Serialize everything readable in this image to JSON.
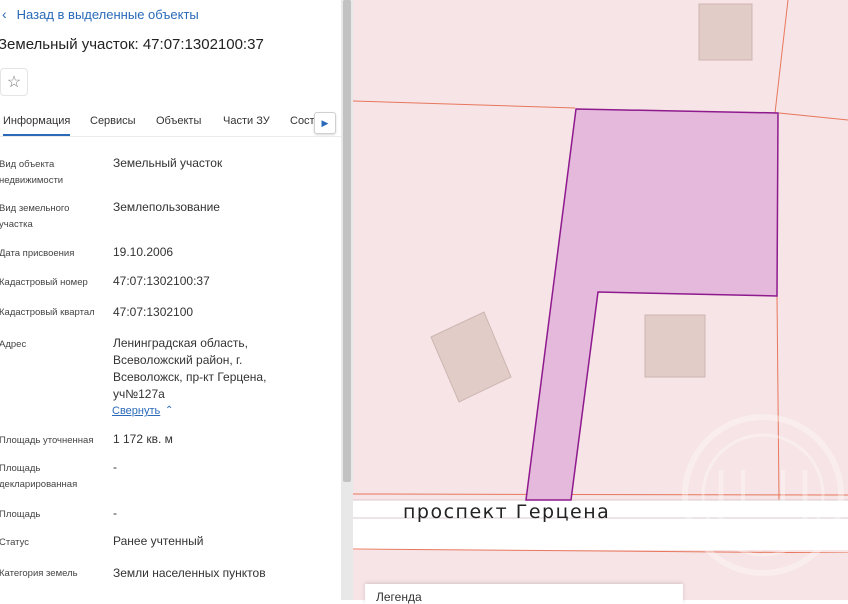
{
  "nav": {
    "back_label": "Назад в выделенные объекты"
  },
  "object": {
    "title": "Земельный участок: 47:07:1302100:37",
    "favorite_icon": "star-icon"
  },
  "tabs": [
    {
      "label": "Информация",
      "active": true
    },
    {
      "label": "Сервисы",
      "active": false
    },
    {
      "label": "Объекты",
      "active": false
    },
    {
      "label": "Части ЗУ",
      "active": false
    },
    {
      "label": "Сост",
      "active": false
    }
  ],
  "props": [
    {
      "label": "Вид объекта недвижимости",
      "value": "Земельный участок"
    },
    {
      "label": "Вид земельного участка",
      "value": "Землепользование"
    },
    {
      "label": "Дата присвоения",
      "value": "19.10.2006"
    },
    {
      "label": "Кадастровый номер",
      "value": "47:07:1302100:37"
    },
    {
      "label": "Кадастровый квартал",
      "value": "47:07:1302100"
    },
    {
      "label": "Адрес",
      "value": "Ленинградская область, Всеволожский район, г. Всеволожск, пр-кт Герцена, уч№127а"
    },
    {
      "label": "Площадь уточненная",
      "value": "1 172 кв. м"
    },
    {
      "label": "Площадь декларированная",
      "value": "-"
    },
    {
      "label": "Площадь",
      "value": "-"
    },
    {
      "label": "Статус",
      "value": "Ранее учтенный"
    },
    {
      "label": "Категория земель",
      "value": "Земли населенных пунктов"
    }
  ],
  "address_toggle": "Свернуть",
  "map": {
    "street_label": "проспект Герцена",
    "legend_title": "Легенда",
    "colors": {
      "background": "#f6e4e6",
      "boundary": "#e8775c",
      "parcel_fill": "#e4b9dc",
      "parcel_stroke": "#8e1a8e",
      "building": "#e2ccc8"
    }
  }
}
